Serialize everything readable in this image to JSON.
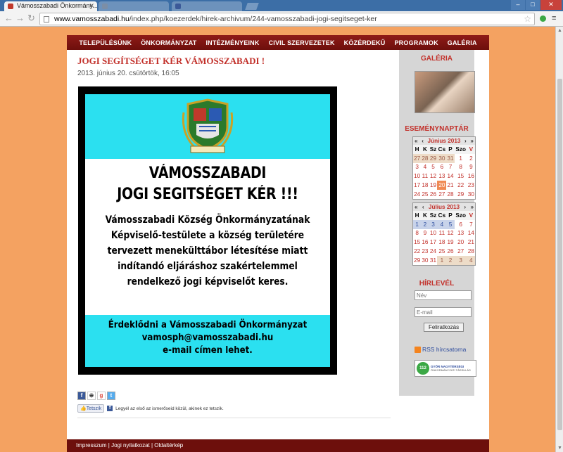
{
  "browser": {
    "active_tab": "Vámosszabadi Önkormány...",
    "bg_tabs": [
      "",
      ""
    ],
    "url_host": "www.vamosszabadi.hu",
    "url_path": "/index.php/koezerdek/hirek-archivum/244-vamosszabadi-jogi-segitseget-ker",
    "win_controls": [
      "–",
      "□",
      "✕"
    ]
  },
  "nav": [
    "TELEPÜLÉSÜNK",
    "ÖNKORMÁNYZAT",
    "INTÉZMÉNYEINK",
    "CIVIL SZERVEZETEK",
    "KÖZÉRDEKŰ",
    "PROGRAMOK",
    "GALÉRIA"
  ],
  "article": {
    "title": "JOGI SEGÍTSÉGET KÉR VÁMOSSZABADI !",
    "date": "2013. június 20. csütörtök, 16:05"
  },
  "poster": {
    "crest_label": "VÁMOSSZABADI",
    "heading1": "VÁMOSSZABADI",
    "heading2": "JOGI SEGITSÉGET KÉR !!!",
    "body": [
      "Vámosszabadi Község Önkormányzatának",
      "Képviselő-testülete a község területére",
      "tervezett menekülttábor létesítése miatt",
      "indítandó eljáráshoz szakértelemmel",
      "rendelkező jogi képviselőt keres."
    ],
    "footer": [
      "Érdeklődni a Vámosszabadi Önkormányzat",
      "vamosph@vamosszabadi.hu",
      "e-mail címen lehet."
    ]
  },
  "social": {
    "like_btn": "Tetszik",
    "like_text": "Legyél az első az ismerőseid közül, akinek ez tetszik."
  },
  "sidebar": {
    "gallery_title": "GALÉRIA",
    "events_title": "ESEMÉNYNAPTÁR",
    "cal1_month": "Június 2013",
    "cal2_month": "Július 2013",
    "weekdays": [
      "H",
      "K",
      "Sz",
      "Cs",
      "P",
      "Szo",
      "V"
    ],
    "newsletter_title": "HÍRLEVÉL",
    "name_placeholder": "Név",
    "email_placeholder": "E-mail",
    "subscribe_btn": "Feliratkozás",
    "rss_label": "RSS hírcsatorna",
    "badge_num": "112",
    "badge_title": "GYŐR NAGYTÉRSÉGI",
    "badge_sub": "ÖNKORMÁNYZATI TÁRSULÁS"
  },
  "footer": {
    "links": "Impresszum | Jogi nyilatkozat | Oldaltérkép"
  }
}
